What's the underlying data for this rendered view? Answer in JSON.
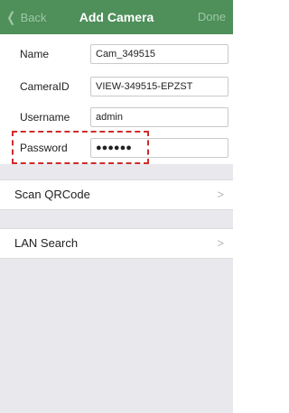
{
  "nav": {
    "back_label": "Back",
    "title": "Add Camera",
    "done_label": "Done"
  },
  "form": {
    "name": {
      "label": "Name",
      "value": "Cam_349515"
    },
    "camera_id": {
      "label": "CameraID",
      "value": "VIEW-349515-EPZST"
    },
    "username": {
      "label": "Username",
      "value": "admin"
    },
    "password": {
      "label": "Password",
      "value": "●●●●●●"
    }
  },
  "menu": {
    "scan_label": "Scan QRCode",
    "lan_label": "LAN Search"
  },
  "colors": {
    "navbar": "#4e8f5a",
    "highlight": "#cf2b2b",
    "background": "#e8e8ed"
  },
  "icons": {
    "back": "chevron-left-icon",
    "row_disclosure": "chevron-right-icon"
  }
}
